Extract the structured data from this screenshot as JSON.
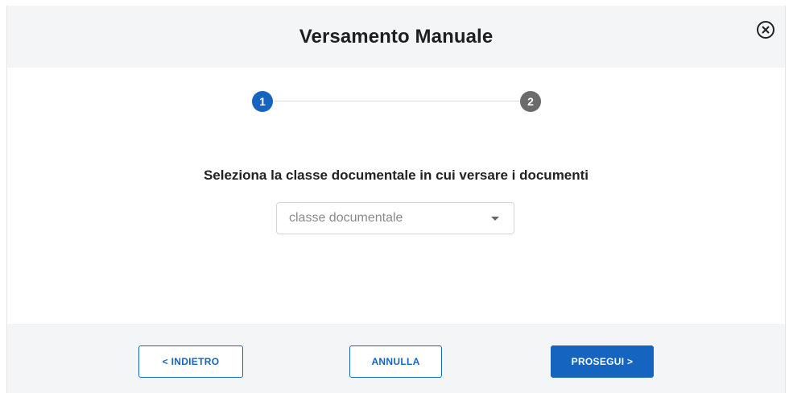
{
  "dialog": {
    "title": "Versamento Manuale",
    "close_icon": "circle-x-icon"
  },
  "stepper": {
    "steps": [
      {
        "number": "1",
        "state": "active",
        "color": "#1565c0"
      },
      {
        "number": "2",
        "state": "inactive",
        "color": "#6b6b6b"
      }
    ]
  },
  "content": {
    "instruction": "Seleziona la classe documentale in cui versare i documenti",
    "class_select": {
      "placeholder": "classe documentale",
      "icon": "chevron-down-icon"
    }
  },
  "footer": {
    "back_label": "< INDIETRO",
    "cancel_label": "ANNULLA",
    "next_label": "PROSEGUI >"
  },
  "colors": {
    "accent": "#1565c0",
    "header_bg": "#f4f5f7",
    "inactive_step": "#6b6b6b"
  }
}
